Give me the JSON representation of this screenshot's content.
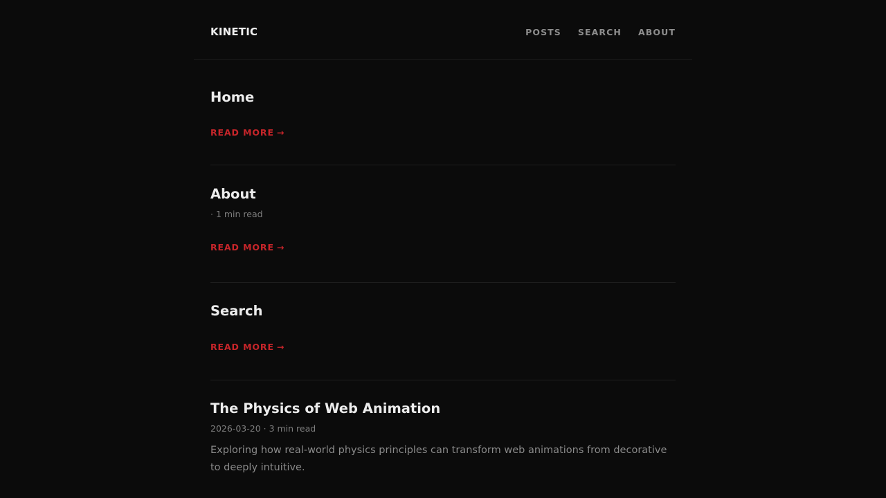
{
  "header": {
    "brand": "KINETIC",
    "nav": [
      "POSTS",
      "SEARCH",
      "ABOUT"
    ]
  },
  "posts": [
    {
      "title": "Home",
      "meta": "",
      "excerpt": "",
      "read_more": "READ MORE",
      "arrow": "→"
    },
    {
      "title": "About",
      "meta": "· 1 min read",
      "excerpt": "",
      "read_more": "READ MORE",
      "arrow": "→"
    },
    {
      "title": "Search",
      "meta": "",
      "excerpt": "",
      "read_more": "READ MORE",
      "arrow": "→"
    },
    {
      "title": "The Physics of Web Animation",
      "meta": "2026-03-20 · 3 min read",
      "excerpt": "Exploring how real-world physics principles can transform web animations from decorative to deeply intuitive.",
      "read_more": "",
      "arrow": ""
    }
  ],
  "colors": {
    "background": "#0b0b0b",
    "accent": "#c7252a",
    "text": "#ececec",
    "muted": "#8a8a8a"
  }
}
